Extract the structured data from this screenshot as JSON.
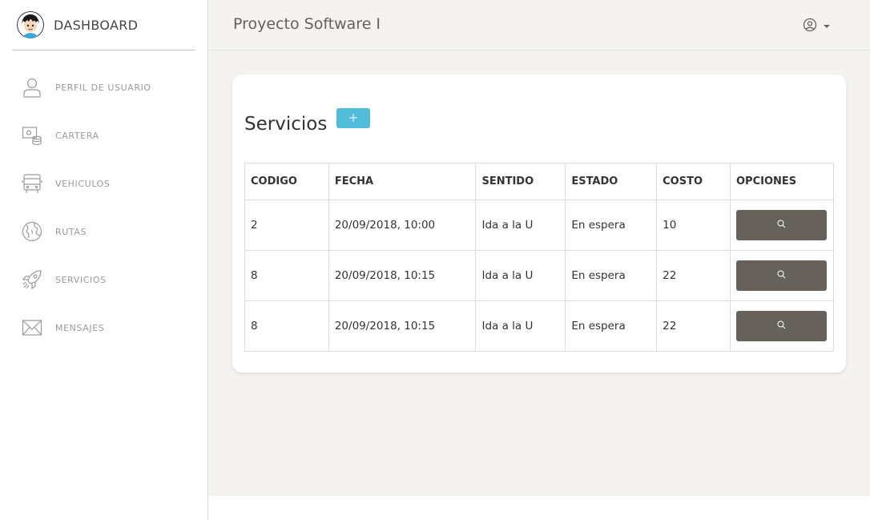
{
  "sidebar": {
    "brand": "DASHBOARD",
    "items": [
      {
        "label": "PERFIL DE USUARIO",
        "icon": "user-icon"
      },
      {
        "label": "CARTERA",
        "icon": "wallet-icon"
      },
      {
        "label": "VEHICULOS",
        "icon": "bus-icon"
      },
      {
        "label": "RUTAS",
        "icon": "globe-icon"
      },
      {
        "label": "SERVICIOS",
        "icon": "rocket-icon"
      },
      {
        "label": "MENSAJES",
        "icon": "envelope-icon"
      }
    ]
  },
  "header": {
    "title": "Proyecto Software I",
    "user_icon": "user-circle-icon"
  },
  "card": {
    "title": "Servicios",
    "add_label": "+",
    "columns": [
      "CODIGO",
      "FECHA",
      "SENTIDO",
      "ESTADO",
      "COSTO",
      "OPCIONES"
    ],
    "rows": [
      {
        "codigo": "2",
        "fecha": "20/09/2018, 10:00",
        "sentido": "Ida a la U",
        "estado": "En espera",
        "costo": "10"
      },
      {
        "codigo": "8",
        "fecha": "20/09/2018, 10:15",
        "sentido": "Ida a la U",
        "estado": "En espera",
        "costo": "22"
      },
      {
        "codigo": "8",
        "fecha": "20/09/2018, 10:15",
        "sentido": "Ida a la U",
        "estado": "En espera",
        "costo": "22"
      }
    ]
  },
  "colors": {
    "accent": "#51bcda",
    "button_dark": "#66615b",
    "background": "#f4f3ef"
  }
}
